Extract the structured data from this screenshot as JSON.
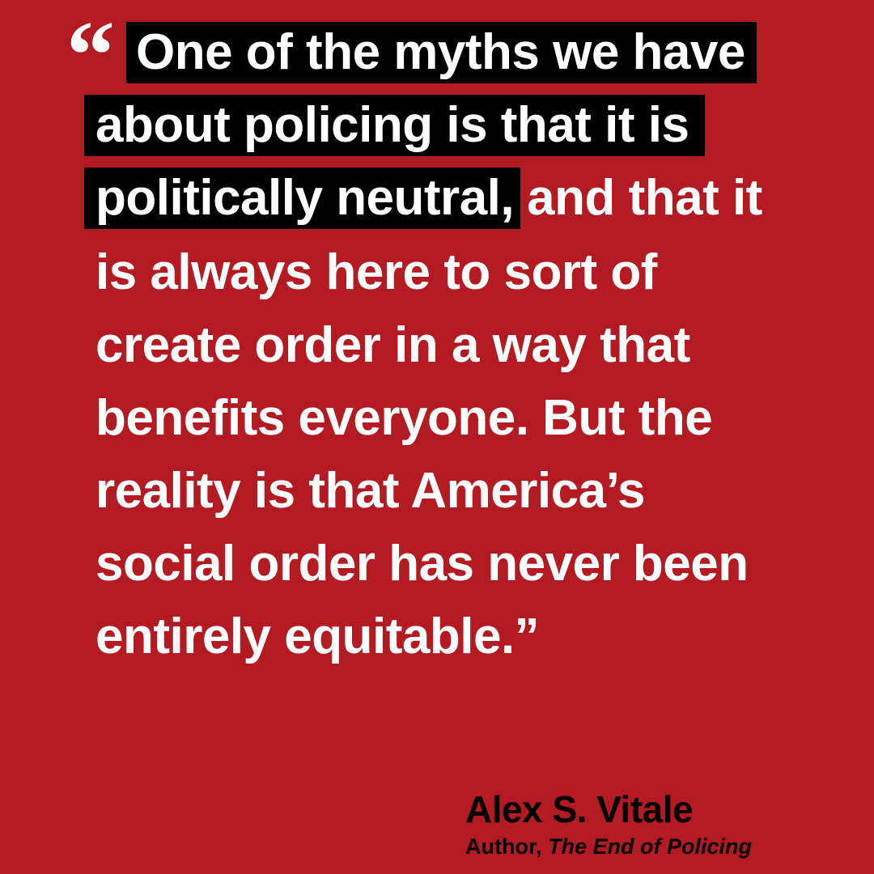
{
  "quote": {
    "open_mark": "“",
    "lines": [
      {
        "highlighted": "One of the myths we have",
        "plain": ""
      },
      {
        "highlighted": "about policing is that it is",
        "plain": ""
      },
      {
        "highlighted": "politically neutral,",
        "plain": "and that it"
      },
      {
        "highlighted": "",
        "plain": "is always here to sort of"
      },
      {
        "highlighted": "",
        "plain": "create order in a way that"
      },
      {
        "highlighted": "",
        "plain": "benefits everyone. But the"
      },
      {
        "highlighted": "",
        "plain": "reality is that America’s"
      },
      {
        "highlighted": "",
        "plain": "social order has never been"
      },
      {
        "highlighted": "",
        "plain": "entirely equitable.”"
      }
    ]
  },
  "attribution": {
    "name": "Alex S. Vitale",
    "role_prefix": "Author,",
    "book_title": "The End of Policing"
  },
  "colors": {
    "background": "#b31a22",
    "highlight": "#000000",
    "quote_text": "#ffffff",
    "attribution_text": "#000000"
  }
}
